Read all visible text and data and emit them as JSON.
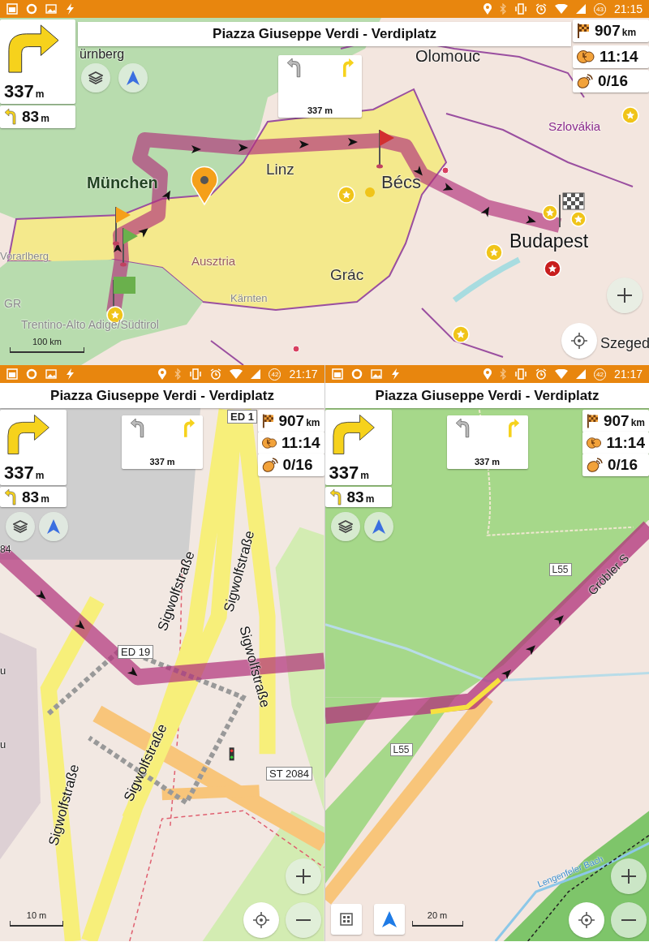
{
  "screens": [
    {
      "kind": "wide",
      "status_bar": {
        "time": "21:15",
        "battery": "43"
      },
      "title": "Piazza Giuseppe Verdi - Verdiplatz",
      "turn": {
        "distance": "337",
        "unit": "m"
      },
      "next_turn": {
        "distance": "83",
        "unit": "m"
      },
      "lanes": {
        "distance": "337 m"
      },
      "stats": [
        {
          "kind": "distance",
          "value": "907",
          "unit": "km"
        },
        {
          "kind": "time",
          "value": "11:14"
        },
        {
          "kind": "points",
          "value": "0/16"
        }
      ],
      "map": {
        "kind": "overview",
        "labels": [
          "Olomouc",
          "ürnberg",
          "Szlovákia",
          "München",
          "Linz",
          "Bécs",
          "Budapest",
          "Vorarlberg",
          "Ausztria",
          "Grác",
          "Kärnten",
          "GR",
          "Trentino-Alto Adige/Südtirol",
          "Szeged"
        ]
      },
      "scale": "100 km",
      "map_buttons": [
        {
          "kind": "layers"
        },
        {
          "kind": "compass"
        },
        {
          "kind": "zoom_in"
        },
        {
          "kind": "locate"
        }
      ]
    },
    {
      "kind": "narrow",
      "status_bar": {
        "time": "21:17",
        "battery": "42"
      },
      "title": "Piazza Giuseppe Verdi - Verdiplatz",
      "turn": {
        "distance": "337",
        "unit": "m"
      },
      "next_turn": {
        "distance": "83",
        "unit": "m"
      },
      "lanes": {
        "distance": "337 m"
      },
      "stats": [
        {
          "kind": "distance",
          "value": "907",
          "unit": "km"
        },
        {
          "kind": "time",
          "value": "11:14"
        },
        {
          "kind": "points",
          "value": "0/16"
        }
      ],
      "map": {
        "kind": "junction",
        "labels": [
          "ED 1",
          "84",
          "Sigwolfstraße",
          "Sigwolfstraße",
          "Sigwolfstraße",
          "ED 19",
          "u",
          "Sigwolfstraße",
          "u",
          "ST 2084",
          "Sigwolfstraße"
        ]
      },
      "scale": "10 m",
      "map_buttons": [
        {
          "kind": "layers"
        },
        {
          "kind": "compass"
        },
        {
          "kind": "zoom_in"
        },
        {
          "kind": "locate"
        },
        {
          "kind": "zoom_out"
        }
      ]
    },
    {
      "kind": "narrow",
      "status_bar": {
        "time": "21:17",
        "battery": "42"
      },
      "title": "Piazza Giuseppe Verdi - Verdiplatz",
      "turn": {
        "distance": "337",
        "unit": "m"
      },
      "next_turn": {
        "distance": "83",
        "unit": "m"
      },
      "lanes": {
        "distance": "337 m"
      },
      "stats": [
        {
          "kind": "distance",
          "value": "907",
          "unit": "km"
        },
        {
          "kind": "time",
          "value": "11:14"
        },
        {
          "kind": "points",
          "value": "0/16"
        }
      ],
      "map": {
        "kind": "forest",
        "labels": [
          "Gröbler S",
          "L55",
          "L55",
          "Lengenfeler Bach"
        ]
      },
      "scale": "20 m",
      "map_buttons": [
        {
          "kind": "layers"
        },
        {
          "kind": "compass"
        },
        {
          "kind": "grid"
        },
        {
          "kind": "navigate"
        },
        {
          "kind": "zoom_in"
        },
        {
          "kind": "locate"
        },
        {
          "kind": "zoom_out"
        }
      ]
    }
  ]
}
